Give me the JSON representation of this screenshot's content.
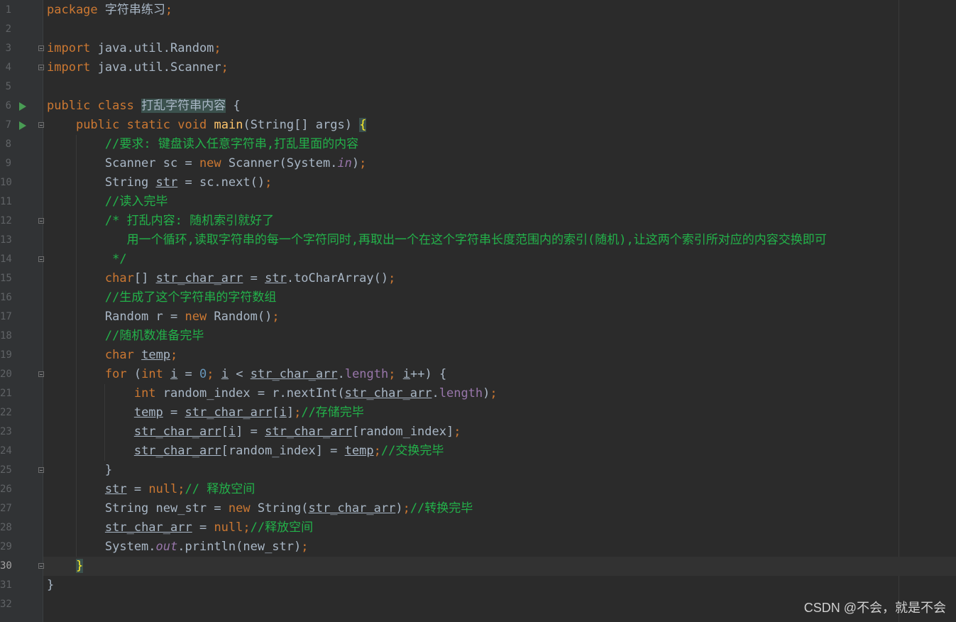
{
  "editor": {
    "lines": [
      {
        "n": "1",
        "text": "package 字符串练习;"
      },
      {
        "n": "2",
        "text": ""
      },
      {
        "n": "3",
        "text": "import java.util.Random;"
      },
      {
        "n": "4",
        "text": "import java.util.Scanner;"
      },
      {
        "n": "5",
        "text": ""
      },
      {
        "n": "6",
        "text": "public class 打乱字符串内容 {"
      },
      {
        "n": "7",
        "text": "    public static void main(String[] args) {"
      },
      {
        "n": "8",
        "text": "        //要求: 键盘读入任意字符串,打乱里面的内容"
      },
      {
        "n": "9",
        "text": "        Scanner sc = new Scanner(System.in);"
      },
      {
        "n": "10",
        "text": "        String str = sc.next();"
      },
      {
        "n": "11",
        "text": "        //读入完毕"
      },
      {
        "n": "12",
        "text": "        /* 打乱内容: 随机索引就好了"
      },
      {
        "n": "13",
        "text": "           用一个循环,读取字符串的每一个字符同时,再取出一个在这个字符串长度范围内的索引(随机),让这两个索引所对应的内容交换即可"
      },
      {
        "n": "14",
        "text": "         */"
      },
      {
        "n": "15",
        "text": "        char[] str_char_arr = str.toCharArray();"
      },
      {
        "n": "16",
        "text": "        //生成了这个字符串的字符数组"
      },
      {
        "n": "17",
        "text": "        Random r = new Random();"
      },
      {
        "n": "18",
        "text": "        //随机数准备完毕"
      },
      {
        "n": "19",
        "text": "        char temp;"
      },
      {
        "n": "20",
        "text": "        for (int i = 0; i < str_char_arr.length; i++) {"
      },
      {
        "n": "21",
        "text": "            int random_index = r.nextInt(str_char_arr.length);"
      },
      {
        "n": "22",
        "text": "            temp = str_char_arr[i];//存储完毕"
      },
      {
        "n": "23",
        "text": "            str_char_arr[i] = str_char_arr[random_index];"
      },
      {
        "n": "24",
        "text": "            str_char_arr[random_index] = temp;//交换完毕"
      },
      {
        "n": "25",
        "text": "        }"
      },
      {
        "n": "26",
        "text": "        str = null;// 释放空间"
      },
      {
        "n": "27",
        "text": "        String new_str = new String(str_char_arr);//转换完毕"
      },
      {
        "n": "28",
        "text": "        str_char_arr = null;//释放空间"
      },
      {
        "n": "29",
        "text": "        System.out.println(new_str);"
      },
      {
        "n": "30",
        "text": "    }"
      },
      {
        "n": "31",
        "text": "}"
      },
      {
        "n": "32",
        "text": ""
      }
    ],
    "current_line": "30",
    "run_lines": [
      "6",
      "7"
    ],
    "fold_lines": [
      "3",
      "4",
      "7",
      "12",
      "14",
      "20",
      "25",
      "30"
    ]
  },
  "colors": {
    "background": "#2b2b2b",
    "keyword": "#cc7832",
    "function": "#ffc66d",
    "comment": "#23b24a",
    "number": "#6897bb",
    "field": "#9876aa",
    "text": "#a9b7c6",
    "run_icon": "#499c54"
  },
  "watermark": "CSDN @不会，就是不会"
}
